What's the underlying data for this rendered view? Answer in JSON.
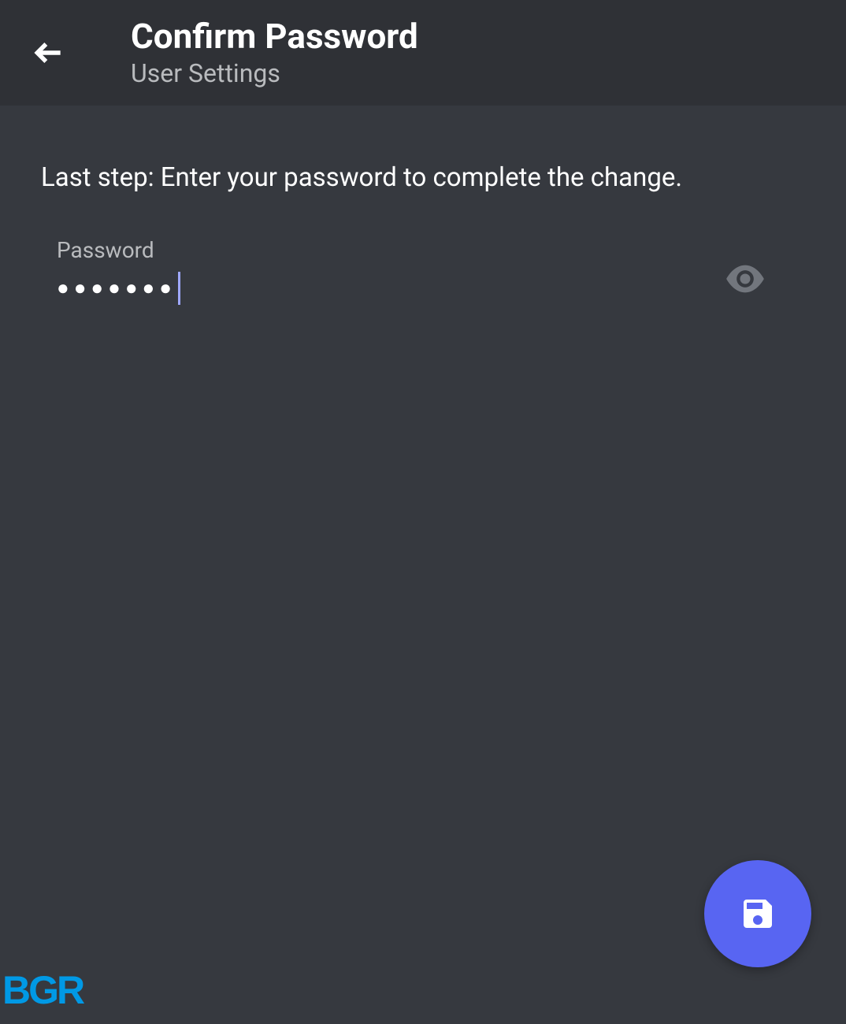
{
  "header": {
    "title": "Confirm Password",
    "subtitle": "User Settings"
  },
  "content": {
    "instruction": "Last step: Enter your password to complete the change.",
    "password_label": "Password",
    "password_masked": "●●●●●●●"
  },
  "watermark": "BGR",
  "colors": {
    "background": "#36393f",
    "header_bg": "#2f3136",
    "accent": "#5865f2",
    "cursor": "#9fa8ff",
    "watermark": "#0099e5"
  }
}
